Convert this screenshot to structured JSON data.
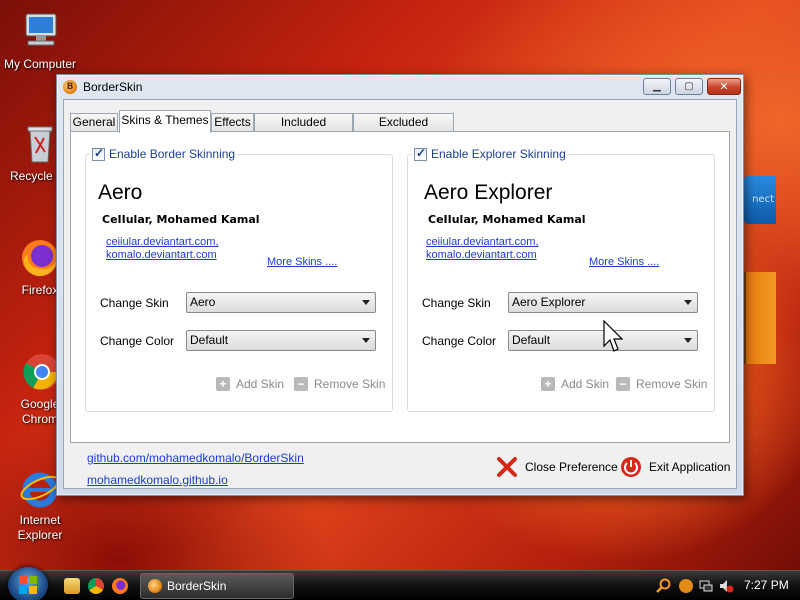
{
  "desktop": {
    "icons": [
      {
        "label": "My Computer"
      },
      {
        "label": "Recycle B"
      },
      {
        "label": "Firefox"
      },
      {
        "label": "Google Chrom"
      },
      {
        "label": "Internet Explorer"
      }
    ]
  },
  "window": {
    "title": "BorderSkin",
    "controls": {
      "minimize": "▁",
      "maximize": "▢",
      "close": "✕"
    },
    "app_icon_letter": "B"
  },
  "tabs": [
    {
      "label": "General",
      "active": false
    },
    {
      "label": "Skins & Themes",
      "active": true
    },
    {
      "label": "Effects",
      "active": false
    },
    {
      "label": "Included Windows",
      "active": false
    },
    {
      "label": "Excluded Windows",
      "active": false
    }
  ],
  "border_group": {
    "checkbox_label": "Enable Border Skinning",
    "skin_name": "Aero",
    "author": "CeIIular, Mohamed Kamal",
    "links": [
      "ceiiular.deviantart.com,",
      "komalo.deviantart.com"
    ],
    "more_skins": "More Skins ....",
    "change_skin_label": "Change Skin",
    "change_skin_value": "Aero",
    "change_color_label": "Change Color",
    "change_color_value": "Default",
    "add_skin": "Add Skin",
    "remove_skin": "Remove Skin"
  },
  "explorer_group": {
    "checkbox_label": "Enable Explorer Skinning",
    "skin_name": "Aero Explorer",
    "author": "CeIIular, Mohamed Kamal",
    "links": [
      "ceiiular.deviantart.com,",
      "komalo.deviantart.com"
    ],
    "more_skins": "More Skins ....",
    "change_skin_label": "Change Skin",
    "change_skin_value": "Aero Explorer",
    "change_color_label": "Change Color",
    "change_color_value": "Default",
    "add_skin": "Add Skin",
    "remove_skin": "Remove Skin"
  },
  "footer": {
    "github_link": "github.com/mohamedkomalo/BorderSkin",
    "site_link": "mohamedkomalo.github.io",
    "close_preference": "Close Preference",
    "exit_application": "Exit Application"
  },
  "gadget": {
    "text": "nect"
  },
  "taskbar": {
    "task_label": "BorderSkin",
    "clock": "7:27 PM"
  },
  "colors": {
    "link": "#1b3ecf",
    "group_label": "#1d3f9a",
    "close_red": "#c6432a"
  }
}
